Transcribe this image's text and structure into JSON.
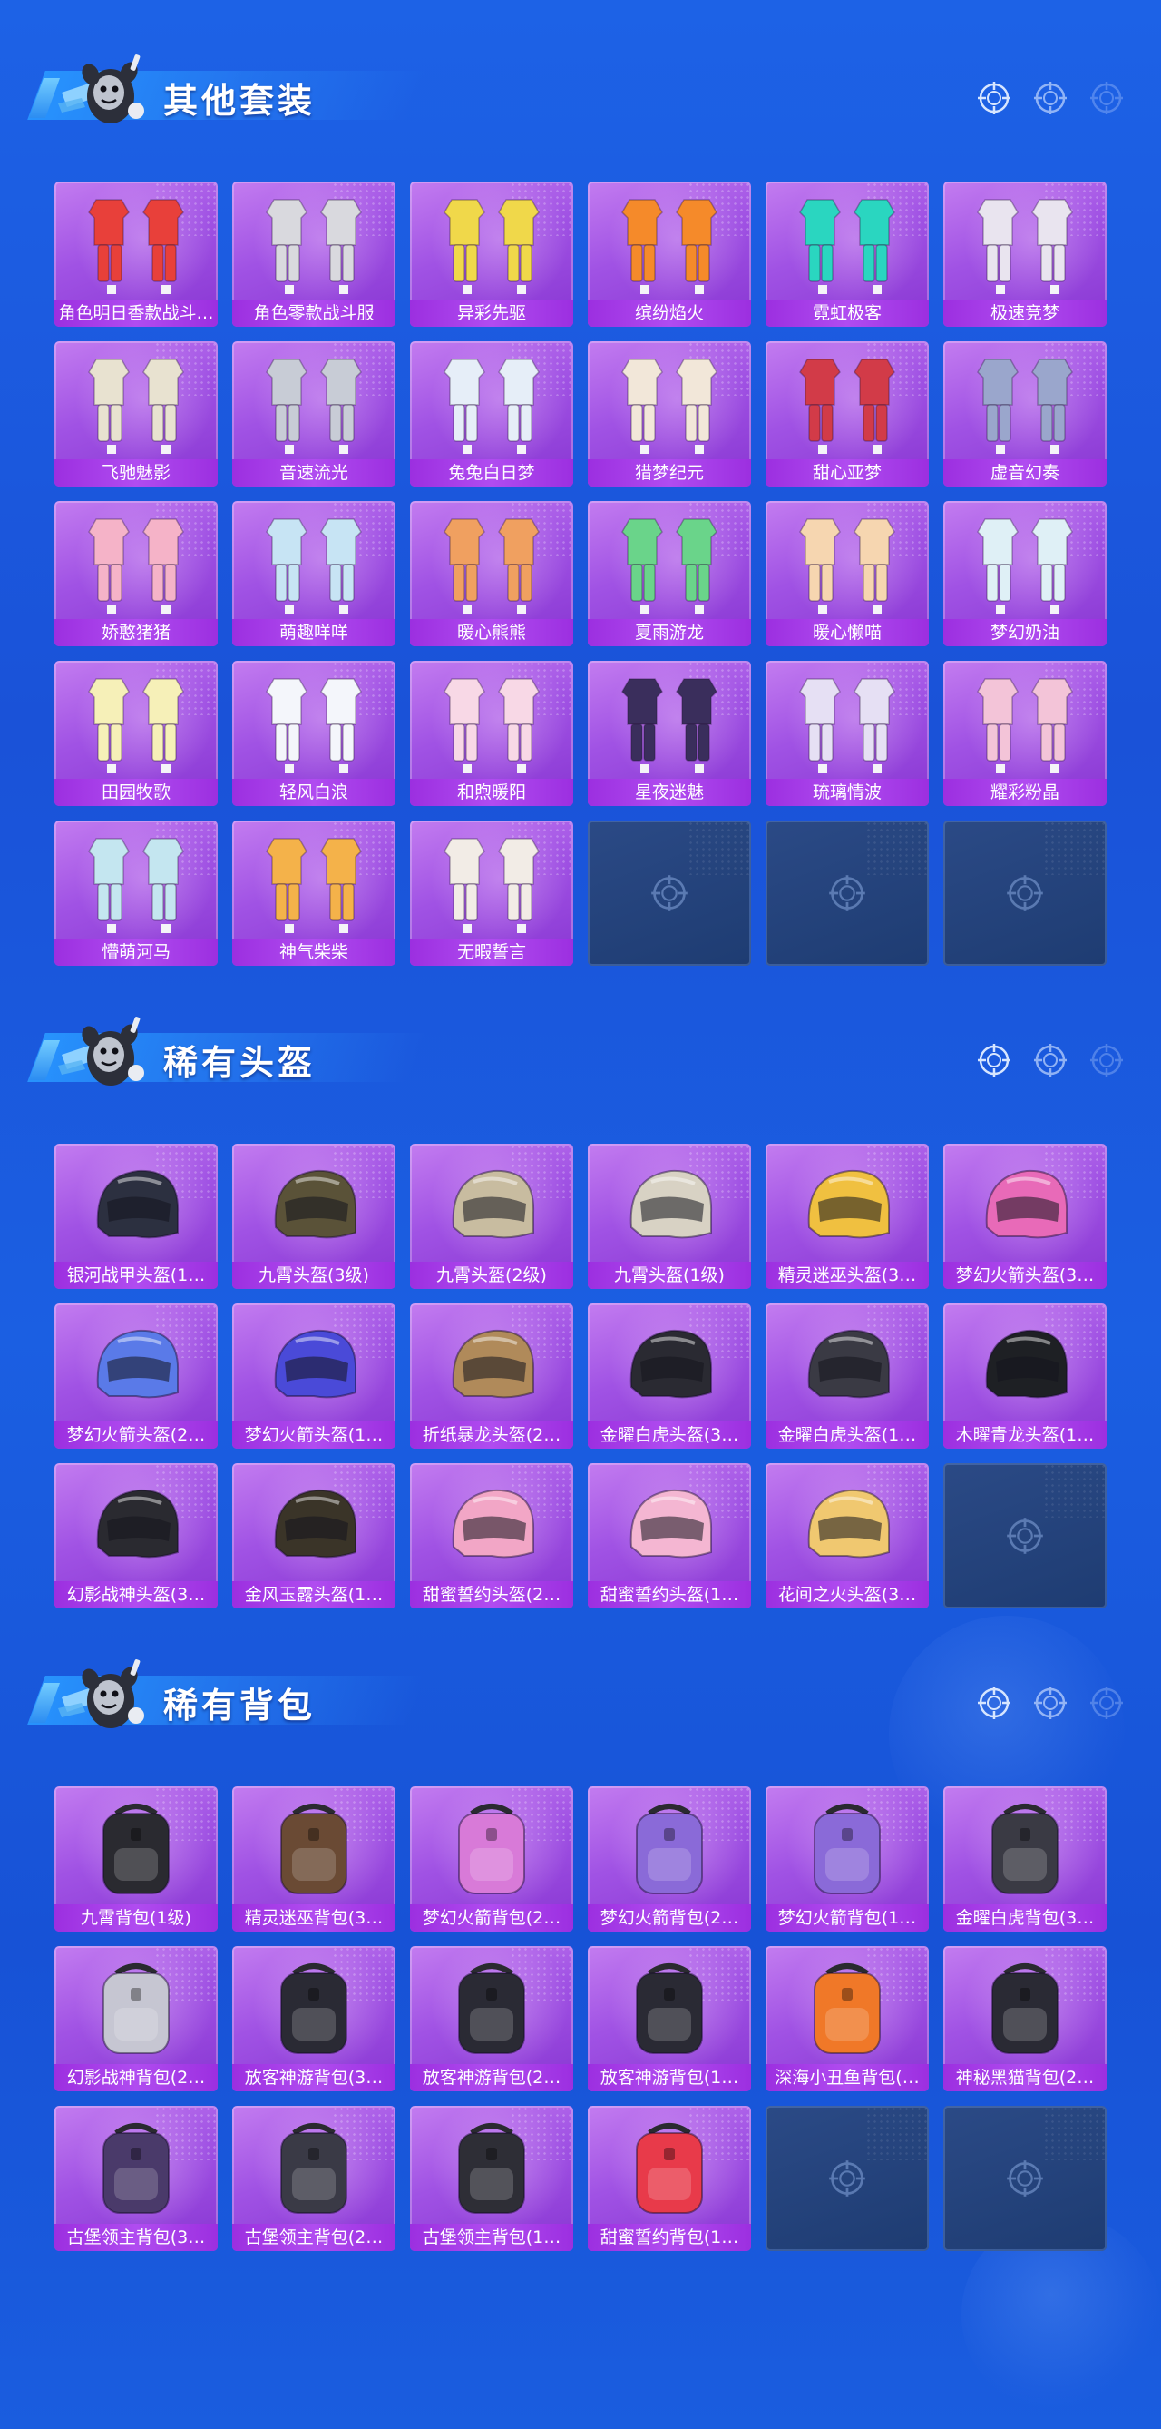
{
  "sections": [
    {
      "title": "其他套装",
      "kind": "suit",
      "items": [
        "角色明日香款战斗…",
        "角色零款战斗服",
        "异彩先驱",
        "缤纷焰火",
        "霓虹极客",
        "极速竞梦",
        "飞驰魅影",
        "音速流光",
        "兔兔白日梦",
        "猎梦纪元",
        "甜心亚梦",
        "虚音幻奏",
        "娇憨猪猪",
        "萌趣咩咩",
        "暖心熊熊",
        "夏雨游龙",
        "暖心懒喵",
        "梦幻奶油",
        "田园牧歌",
        "轻风白浪",
        "和煦暖阳",
        "星夜迷魅",
        "琉璃情波",
        "耀彩粉晶",
        "懵萌河马",
        "神气柴柴",
        "无暇誓言"
      ],
      "empty_slots": 3
    },
    {
      "title": "稀有头盔",
      "kind": "helmet",
      "items": [
        "银河战甲头盔(1…",
        "九霄头盔(3级)",
        "九霄头盔(2级)",
        "九霄头盔(1级)",
        "精灵迷巫头盔(3…",
        "梦幻火箭头盔(3…",
        "梦幻火箭头盔(2…",
        "梦幻火箭头盔(1…",
        "折纸暴龙头盔(2…",
        "金曜白虎头盔(3…",
        "金曜白虎头盔(1…",
        "木曜青龙头盔(1…",
        "幻影战神头盔(3…",
        "金风玉露头盔(1…",
        "甜蜜誓约头盔(2…",
        "甜蜜誓约头盔(1…",
        "花间之火头盔(3…"
      ],
      "empty_slots": 1
    },
    {
      "title": "稀有背包",
      "kind": "backpack",
      "items": [
        "九霄背包(1级)",
        "精灵迷巫背包(3…",
        "梦幻火箭背包(2…",
        "梦幻火箭背包(2…",
        "梦幻火箭背包(1…",
        "金曜白虎背包(3…",
        "幻影战神背包(2…",
        "放客神游背包(3…",
        "放客神游背包(2…",
        "放客神游背包(1…",
        "深海小丑鱼背包(…",
        "神秘黑猫背包(2…",
        "古堡领主背包(3…",
        "古堡领主背包(2…",
        "古堡领主背包(1…",
        "甜蜜誓约背包(1…"
      ],
      "empty_slots": 2
    }
  ],
  "palette": {
    "suit": [
      "#e8403a",
      "#d9d9de",
      "#f0d84a",
      "#f58a2a",
      "#2ad6c0",
      "#e9e4ef",
      "#e8e2d0",
      "#c8ccd6",
      "#e6eef8",
      "#f2e7d9",
      "#d23b48",
      "#9aa6cc",
      "#f5b3c8",
      "#c7e4f4",
      "#f0a060",
      "#6ad48a",
      "#f6d6b0",
      "#dff0f6",
      "#f6f0b8",
      "#f4f6fb",
      "#f8d8e6",
      "#3a2e5c",
      "#e6e0f4",
      "#f3c4d8",
      "#c4e6f0",
      "#f4b24a",
      "#f2ece6"
    ],
    "helmet": [
      "#2c3040",
      "#5a5238",
      "#c8bca0",
      "#d8d2c4",
      "#f0c040",
      "#e86ab8",
      "#5a7ae8",
      "#4a4ad8",
      "#b08a5a",
      "#2a2a32",
      "#3a3a44",
      "#1e2024",
      "#2a2a30",
      "#3a3428",
      "#f2a6c6",
      "#f4b6d2",
      "#f0c870"
    ],
    "backpack": [
      "#2a2a30",
      "#6a4a34",
      "#d87ad8",
      "#8a6ad8",
      "#8a6ad8",
      "#3a3a44",
      "#c6c6d2",
      "#2a2a34",
      "#2a2a34",
      "#2a2a34",
      "#f07828",
      "#2a2a34",
      "#4a3a6a",
      "#3a3a46",
      "#2e2e36",
      "#e83a4a"
    ]
  }
}
